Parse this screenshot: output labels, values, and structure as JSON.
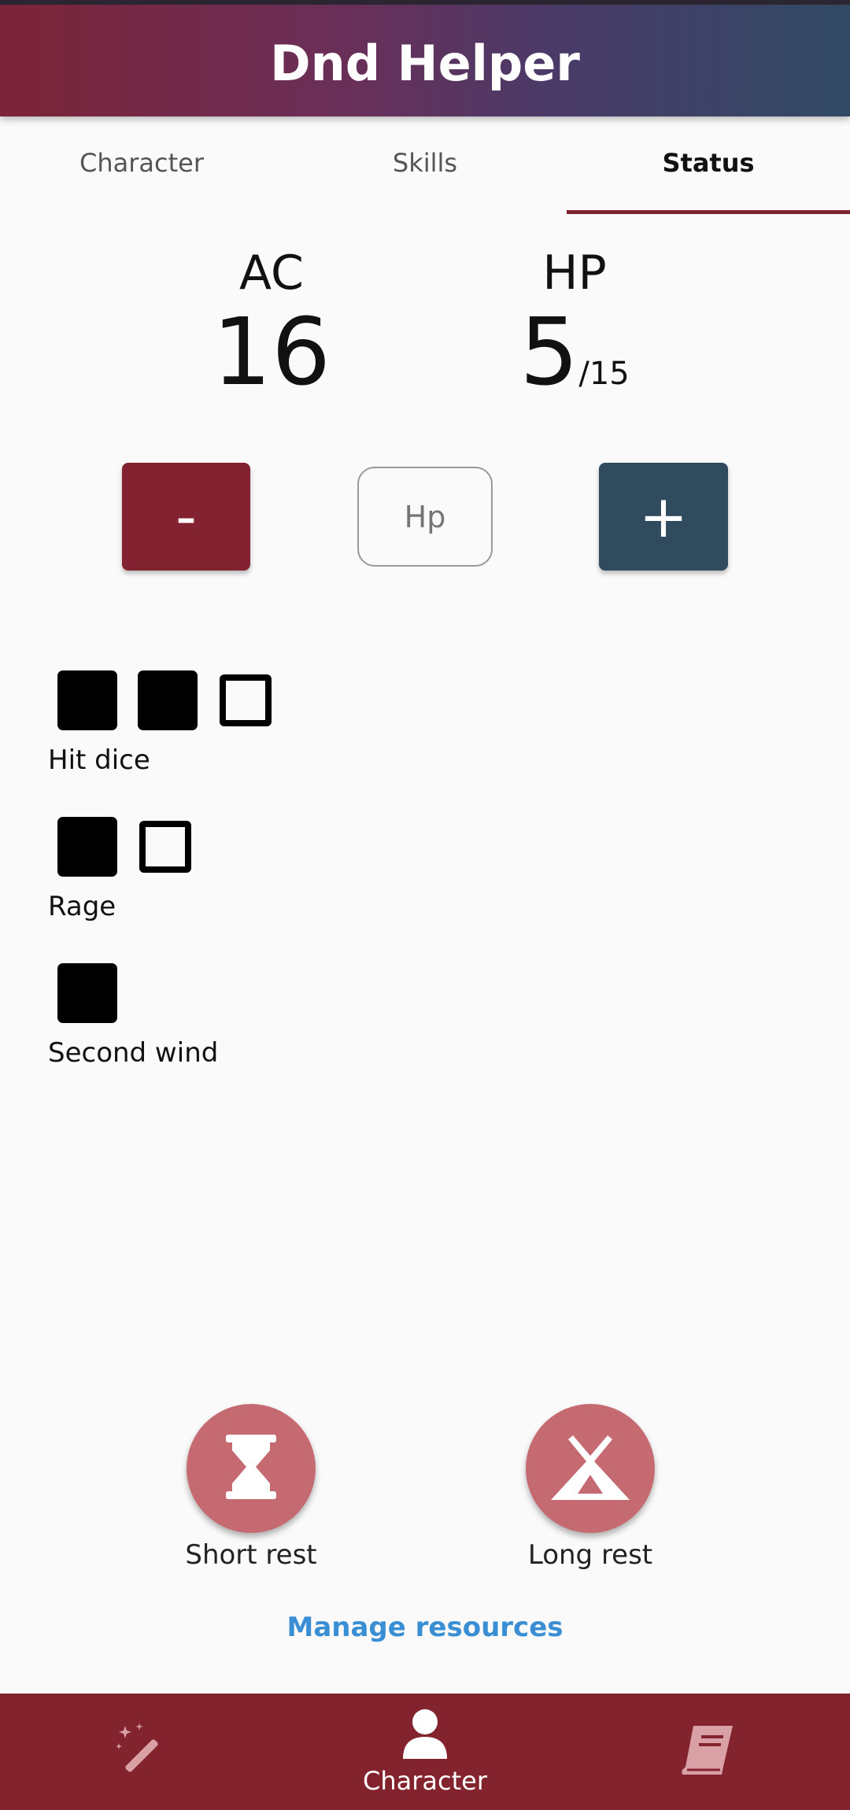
{
  "app": {
    "title": "Dnd Helper"
  },
  "tabs": [
    {
      "label": "Character",
      "active": false
    },
    {
      "label": "Skills",
      "active": false
    },
    {
      "label": "Status",
      "active": true
    }
  ],
  "stats": {
    "ac": {
      "label": "AC",
      "value": "16"
    },
    "hp": {
      "label": "HP",
      "current": "5",
      "max": "/15"
    }
  },
  "hp_controls": {
    "decrease_label": "-",
    "increase_label": "+",
    "input_placeholder": "Hp"
  },
  "resources": [
    {
      "name": "Hit dice",
      "total": 3,
      "used": 2
    },
    {
      "name": "Rage",
      "total": 2,
      "used": 1
    },
    {
      "name": "Second wind",
      "total": 1,
      "used": 1
    }
  ],
  "rest": {
    "short": {
      "label": "Short rest",
      "icon": "hourglass-icon"
    },
    "long": {
      "label": "Long rest",
      "icon": "tent-icon"
    }
  },
  "manage_link": "Manage resources",
  "bottom_nav": [
    {
      "icon": "magic-wand-icon",
      "label": ""
    },
    {
      "icon": "person-icon",
      "label": "Character",
      "active": true
    },
    {
      "icon": "book-icon",
      "label": ""
    }
  ],
  "colors": {
    "primary": "#82232e",
    "secondary": "#304a5e",
    "rest_button": "#c66a72",
    "link": "#3a8fd4"
  }
}
